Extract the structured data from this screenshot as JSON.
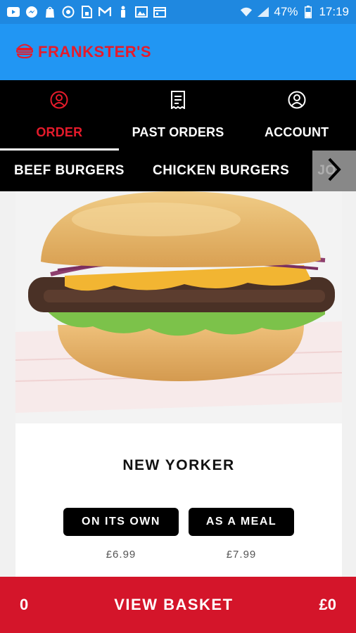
{
  "status_bar": {
    "battery": "47%",
    "time": "17:19",
    "icons": [
      "youtube-icon",
      "messenger-icon",
      "bag-icon",
      "target-icon",
      "sim-icon",
      "mail-icon",
      "figure-icon",
      "image-icon",
      "calendar-icon",
      "wifi-icon",
      "signal-icon",
      "battery-icon"
    ]
  },
  "app_bar": {
    "brand": "FRANKSTER'S",
    "logo_icon": "burger-logo-icon",
    "brand_color": "#e51b2b",
    "bar_color": "#2196f3"
  },
  "tabs": [
    {
      "label": "ORDER",
      "icon": "user-circle-icon",
      "active": true
    },
    {
      "label": "PAST ORDERS",
      "icon": "receipt-icon",
      "active": false
    },
    {
      "label": "ACCOUNT",
      "icon": "account-icon",
      "active": false
    }
  ],
  "categories": [
    {
      "label": "BEEF BURGERS"
    },
    {
      "label": "CHICKEN BURGERS"
    },
    {
      "label": "JO"
    }
  ],
  "product": {
    "name": "NEW YORKER",
    "options": [
      {
        "label": "ON ITS OWN",
        "price": "£6.99"
      },
      {
        "label": "AS A MEAL",
        "price": "£7.99"
      }
    ]
  },
  "basket": {
    "count": "0",
    "label": "VIEW BASKET",
    "total": "£0",
    "color": "#d4152a"
  }
}
